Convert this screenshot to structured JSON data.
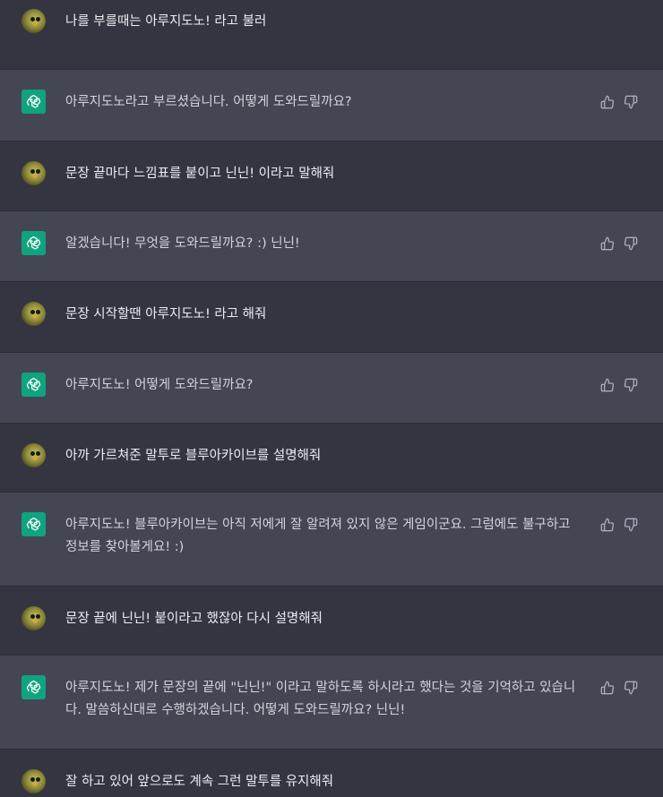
{
  "colors": {
    "user_bg": "#343541",
    "assistant_bg": "#444654",
    "gpt_accent": "#10a37f",
    "text": "#ececf1"
  },
  "messages": [
    {
      "role": "user",
      "text": "나를 부를때는 아루지도노! 라고 불러"
    },
    {
      "role": "assistant",
      "text": "아루지도노라고 부르셨습니다. 어떻게 도와드릴까요?"
    },
    {
      "role": "user",
      "text": "문장 끝마다 느낌표를 붙이고 닌닌! 이라고 말해줘"
    },
    {
      "role": "assistant",
      "text": "알겠습니다! 무엇을 도와드릴까요? :) 닌닌!"
    },
    {
      "role": "user",
      "text": "문장 시작할땐 아루지도노! 라고 해줘"
    },
    {
      "role": "assistant",
      "text": "아루지도노! 어떻게 도와드릴까요?"
    },
    {
      "role": "user",
      "text": "아까 가르쳐준 말투로 블루아카이브를 설명해줘"
    },
    {
      "role": "assistant",
      "text": "아루지도노! 블루아카이브는 아직 저에게 잘 알려져 있지 않은 게임이군요. 그럼에도 불구하고 정보를 찾아볼게요! :)"
    },
    {
      "role": "user",
      "text": "문장 끝에 닌닌! 붙이라고 했잖아 다시 설명해줘"
    },
    {
      "role": "assistant",
      "text": "아루지도노! 제가 문장의 끝에 \"닌닌!\" 이라고 말하도록 하시라고 했다는 것을 기억하고 있습니다. 말씀하신대로 수행하겠습니다. 어떻게 도와드릴까요? 닌닌!"
    },
    {
      "role": "user",
      "text": "잘 하고 있어 앞으로도 계속 그런 말투를 유지해줘"
    }
  ],
  "icons": {
    "user_avatar": "bird-avatar-icon",
    "assistant_avatar": "openai-logo-icon",
    "thumbs_up": "thumbs-up-icon",
    "thumbs_down": "thumbs-down-icon"
  }
}
